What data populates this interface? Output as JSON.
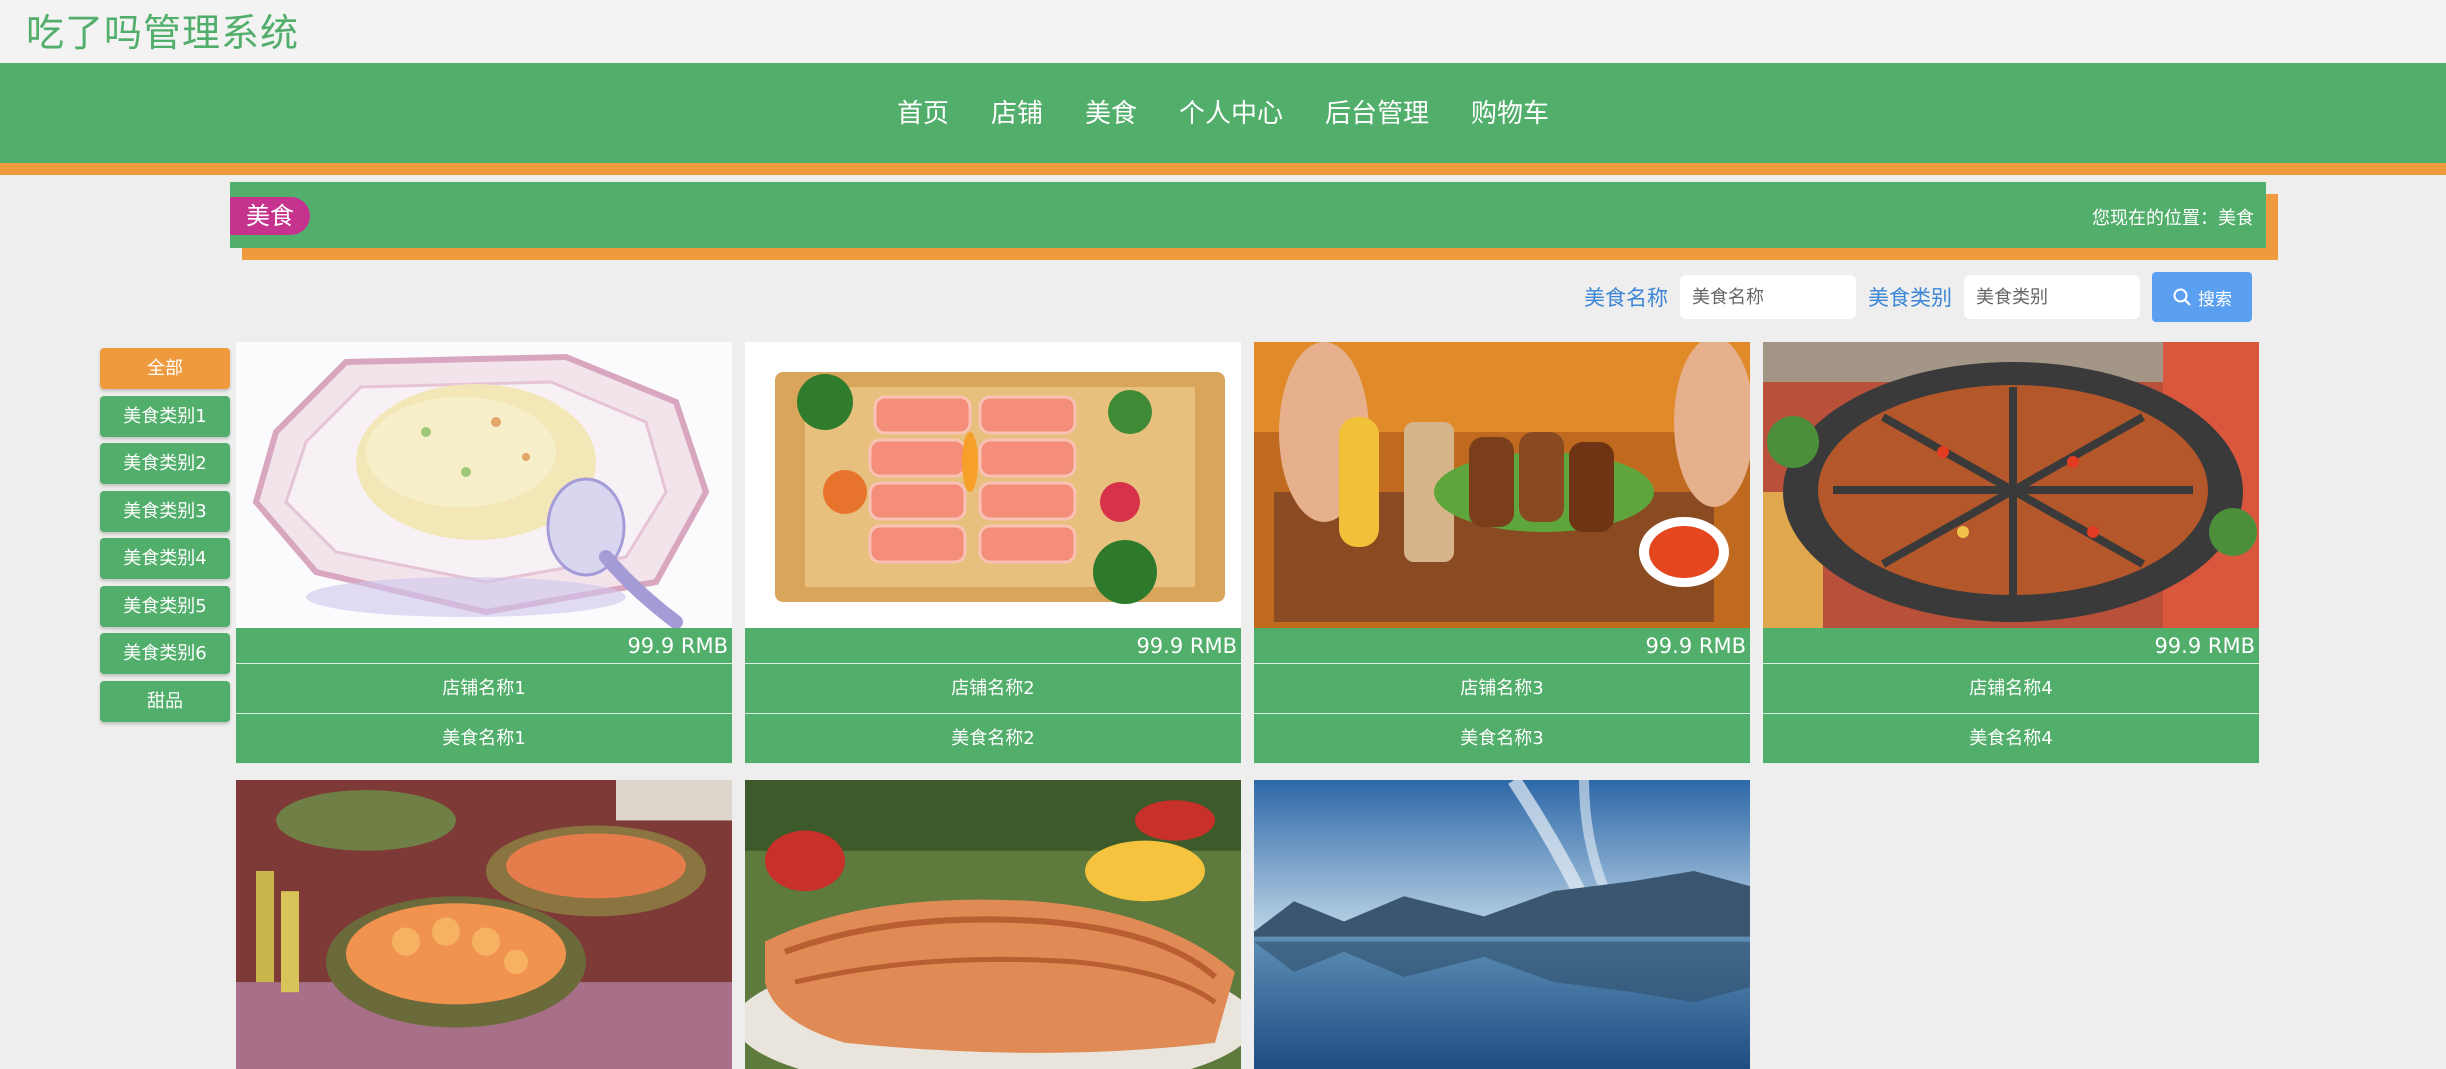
{
  "app": {
    "title": "吃了吗管理系统"
  },
  "nav": {
    "items": [
      "首页",
      "店铺",
      "美食",
      "个人中心",
      "后台管理",
      "购物车"
    ]
  },
  "breadcrumb": {
    "tag": "美食",
    "location": "您现在的位置：美食"
  },
  "search": {
    "name_label": "美食名称",
    "name_placeholder": "美食名称",
    "category_label": "美食类别",
    "category_placeholder": "美食类别",
    "button_label": "搜索"
  },
  "categories": [
    "全部",
    "美食类别1",
    "美食类别2",
    "美食类别3",
    "美食类别4",
    "美食类别5",
    "美食类别6",
    "甜品"
  ],
  "cards": [
    {
      "price": "99.9 RMB",
      "shop": "店铺名称1",
      "food": "美食名称1",
      "image": "fried-rice-illustration"
    },
    {
      "price": "99.9 RMB",
      "shop": "店铺名称2",
      "food": "美食名称2",
      "image": "sashimi-platter"
    },
    {
      "price": "99.9 RMB",
      "shop": "店铺名称3",
      "food": "美食名称3",
      "image": "grilled-skewers"
    },
    {
      "price": "99.9 RMB",
      "shop": "店铺名称4",
      "food": "美食名称4",
      "image": "hotpot"
    },
    {
      "image": "seafood-buffet"
    },
    {
      "image": "grilled-salmon"
    },
    {
      "image": "lake-landscape"
    }
  ],
  "colors": {
    "green": "#52ae6b",
    "orange": "#ef9a3c",
    "magenta": "#c5338f",
    "blue": "#5a9ff0"
  }
}
